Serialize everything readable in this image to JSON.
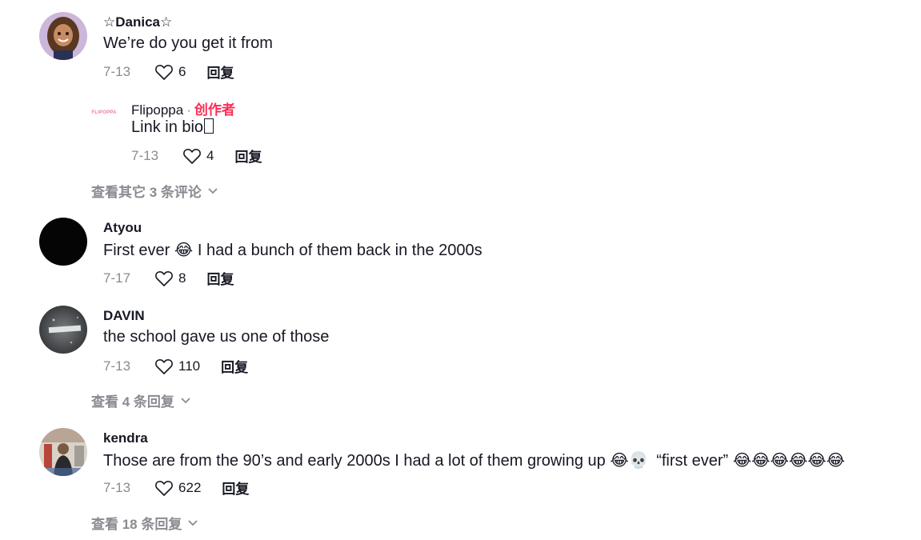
{
  "comments": [
    {
      "username": "☆Danica☆",
      "text": "We’re do you get it from",
      "date": "7-13",
      "likes": "6",
      "reply_label": "回复"
    },
    {
      "username": "Flipoppa",
      "separator": "·",
      "creator_label": "创作者",
      "avatar_text": "FLIPOPPA",
      "text": "Link in bio",
      "date": "7-13",
      "likes": "4",
      "reply_label": "回复"
    },
    {
      "username": "Atyou",
      "text_before": "First ever",
      "emoji": "😂",
      "text_after": "I had a bunch of them back in the 2000s",
      "date": "7-17",
      "likes": "8",
      "reply_label": "回复"
    },
    {
      "username": "DAVIN",
      "text": "the school gave us one of those",
      "date": "7-13",
      "likes": "110",
      "reply_label": "回复"
    },
    {
      "username": "kendra",
      "text_before": "Those are from the 90’s and early 2000s I had a lot of them growing up",
      "emojis_mid": "😂💀",
      "text_quote": "“first ever”",
      "emojis_end": "😂😂😂😂😂😂",
      "date": "7-13",
      "likes": "622",
      "reply_label": "回复"
    }
  ],
  "view_more": {
    "first": "查看其它 3 条评论",
    "second": "查看 4 条回复",
    "third": "查看 18 条回复"
  },
  "icons": {
    "like": "heart-outline-icon",
    "expand": "chevron-down-icon"
  },
  "colors": {
    "creator": "#fe2c55",
    "muted": "#8a8b91"
  }
}
